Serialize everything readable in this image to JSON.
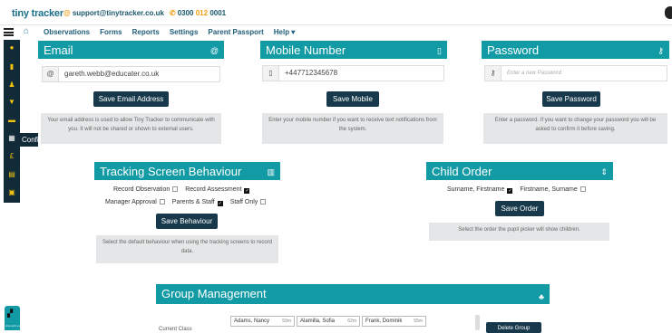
{
  "header": {
    "logo": {
      "part1": "tiny",
      "part2": "tracker"
    },
    "email": "support@tinytracker.co.uk",
    "phone": {
      "a": "0300 ",
      "b": "012",
      "c": " 0001"
    }
  },
  "nav": {
    "items": [
      "Observations",
      "Forms",
      "Reports",
      "Settings",
      "Parent Passport",
      "Help ▾"
    ]
  },
  "sidebar": {
    "tooltip": "Configuration"
  },
  "email_panel": {
    "title": "Email",
    "value": "gareth.webb@educater.co.uk",
    "button": "Save Email Address",
    "info": "Your email address is used to allow Tiny Tracker to communicate with you. It will not be shared or shown to external users."
  },
  "mobile_panel": {
    "title": "Mobile Number",
    "value": "+447712345678",
    "button": "Save Mobile",
    "info": "Enter your mobile number if you want to receive text notifications from the system."
  },
  "password_panel": {
    "title": "Password",
    "placeholder": "Enter a new Password",
    "button": "Save Password",
    "info": "Enter a password. If you want to change your password you will be asked to confirm it before saving."
  },
  "tracking_panel": {
    "title": "Tracking Screen Behaviour",
    "options": [
      "Record Observation",
      "Record Assessment",
      "Manager Approval",
      "Parents & Staff",
      "Staff Only"
    ],
    "button": "Save Behaviour",
    "info": "Select the default behaviour when using the tracking screens to record data."
  },
  "child_order_panel": {
    "title": "Child Order",
    "options": [
      "Surname, Firstname",
      "Firstname, Surname"
    ],
    "button": "Save Order",
    "info": "Select the order the pupil picker will show children."
  },
  "group_panel": {
    "title": "Group Management",
    "children": [
      {
        "name": "Adams, Nancy",
        "age": "59m"
      },
      {
        "name": "Alamilla, Sofia",
        "age": "62m"
      },
      {
        "name": "Frank, Dominik",
        "age": "55m"
      }
    ],
    "label_partial": "Current Class",
    "button_partial": "Delete Group"
  },
  "chat": {
    "label": "chat with us"
  }
}
